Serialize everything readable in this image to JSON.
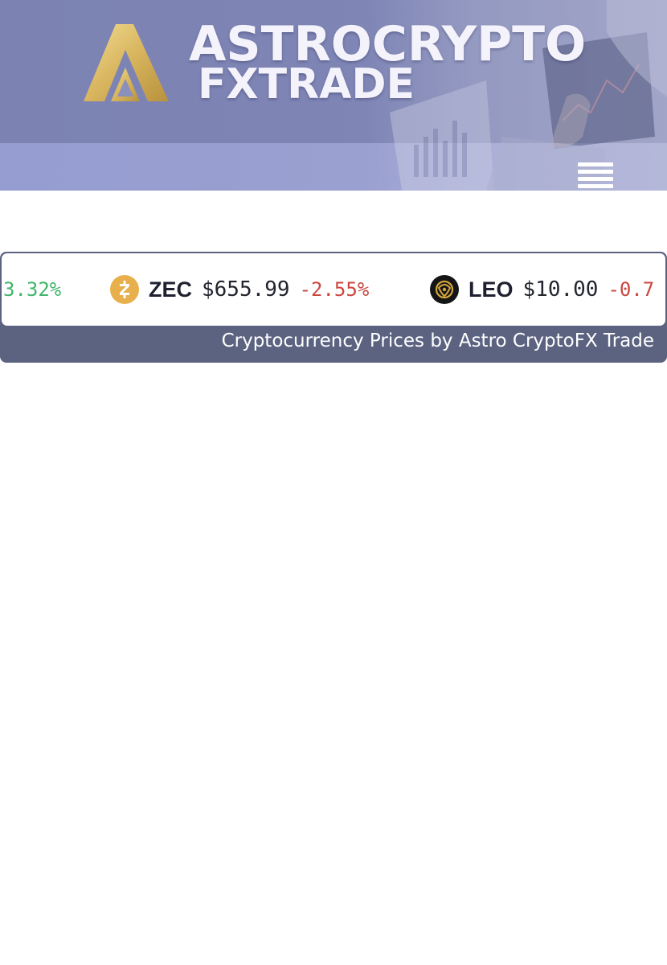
{
  "header": {
    "brand_line1": "ASTROCRYPTO",
    "brand_line2": "FXTRADE",
    "colors": {
      "brand_gold": "#d9b962",
      "header_bg": "#7e85b5",
      "nav_bar_bg": "#989fd0"
    },
    "menu_icon": "hamburger-menu-icon"
  },
  "ticker": {
    "items": [
      {
        "symbol": "",
        "price": "",
        "change": "3.32%",
        "direction": "up"
      },
      {
        "symbol": "ZEC",
        "price": "$655.99",
        "change": "-2.55%",
        "direction": "down",
        "icon": "zcash-icon"
      },
      {
        "symbol": "LEO",
        "price": "$10.00",
        "change": "-0.7",
        "direction": "down",
        "icon": "leo-icon"
      }
    ],
    "credit": "Cryptocurrency Prices by Astro CryptoFX Trade",
    "colors": {
      "positive": "#3fb56a",
      "negative": "#c9473f",
      "footer_bg": "#5b6380"
    }
  }
}
